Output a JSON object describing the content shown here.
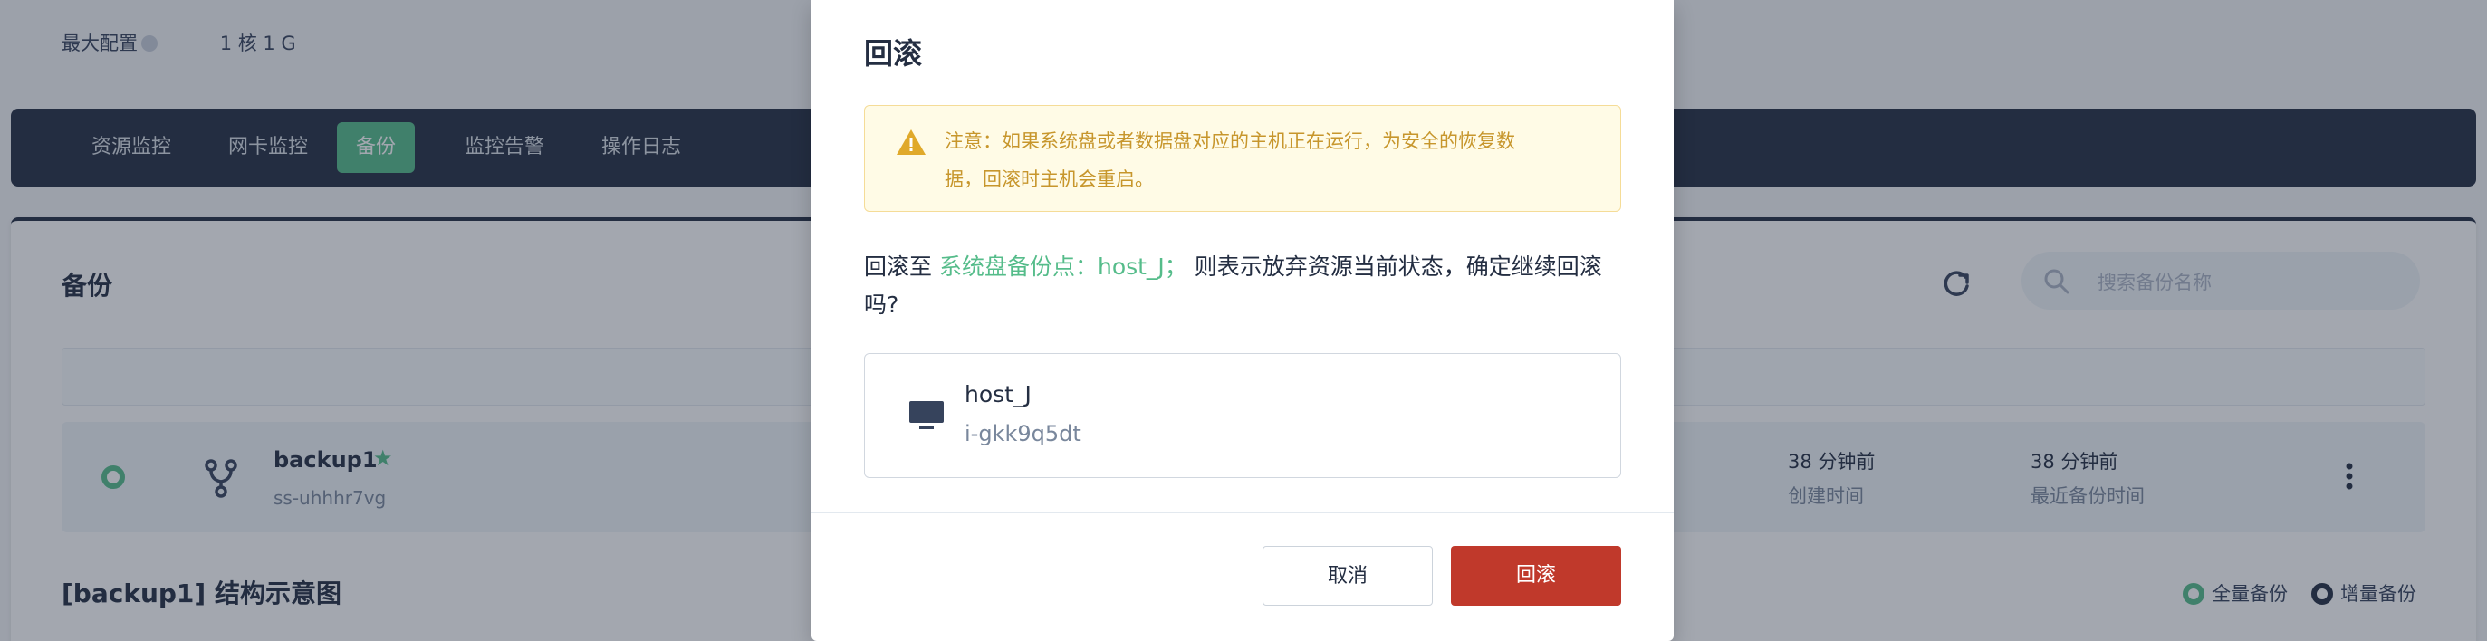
{
  "background": {
    "meta": {
      "max_config_label": "最大配置",
      "max_config_value": "1 核 1 G"
    },
    "nav_tabs": [
      {
        "label": "资源监控",
        "active": false
      },
      {
        "label": "网卡监控",
        "active": false
      },
      {
        "label": "备份",
        "active": true
      },
      {
        "label": "监控告警",
        "active": false
      },
      {
        "label": "操作日志",
        "active": false
      }
    ],
    "card": {
      "title": "备份",
      "search_placeholder": "搜索备份名称"
    },
    "backup_row": {
      "name": "backup1",
      "id": "ss-uhhhr7vg",
      "created_value": "38 分钟前",
      "created_label": "创建时间",
      "last_backup_value": "38 分钟前",
      "last_backup_label": "最近备份时间"
    },
    "schema_title": "[backup1] 结构示意图",
    "legend": {
      "full": "全量备份",
      "incremental": "增量备份"
    }
  },
  "modal": {
    "title": "回滚",
    "warning": "注意：如果系统盘或者数据盘对应的主机正在运行，为安全的恢复数据，回滚时主机会重启。",
    "confirm_prefix": "回滚至",
    "confirm_highlight": "系统盘备份点：host_J；",
    "confirm_suffix": "则表示放弃资源当前状态，确定继续回滚吗?",
    "host": {
      "name": "host_J",
      "id": "i-gkk9q5dt"
    },
    "cancel_label": "取消",
    "ok_label": "回滚"
  },
  "colors": {
    "accent": "#55bc8a",
    "danger": "#c0392b",
    "nav_bg": "#242e42",
    "warning_text": "#c7962c",
    "warning_bg": "#fffbe6"
  }
}
